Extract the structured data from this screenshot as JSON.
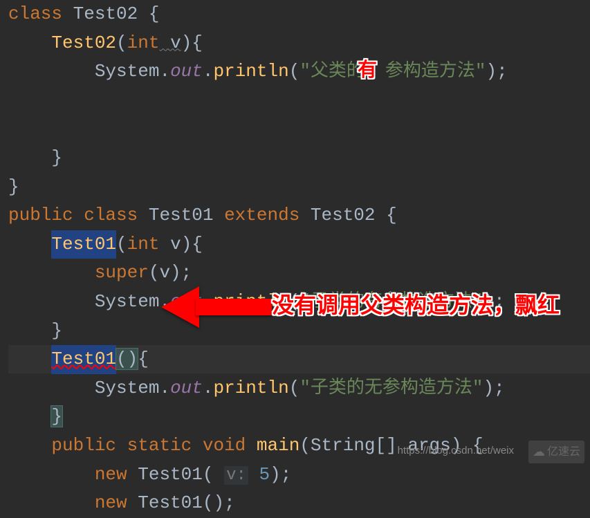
{
  "code": {
    "l0": "}",
    "l1_kw": "class",
    "l1_cls": " Test02 ",
    "l1_br": "{",
    "l2_ctor": "Test02",
    "l2_p1": "(",
    "l2_int": "int",
    "l2_v": " v",
    "l2_p2": "){",
    "l3_sys": "System",
    "l3_dot1": ".",
    "l3_out": "out",
    "l3_dot2": ".",
    "l3_println": "println",
    "l3_p1": "(",
    "l3_str1": "\"父类的",
    "l3_str2": "参构造方法\"",
    "l3_p2": ");",
    "l4_br": "}",
    "l5_br": "}",
    "l6_pub": "public",
    "l6_cls": " class",
    "l6_name": " Test01 ",
    "l6_ext": "extends",
    "l6_sup": " Test02 ",
    "l6_br": "{",
    "l7_ctor": "Test01",
    "l7_p1": "(",
    "l7_int": "int",
    "l7_v": " v",
    "l7_p2": "){",
    "l8_super": "super",
    "l8_p": "(v);",
    "l9_sys": "System",
    "l9_dot1": ".",
    "l9_out": "out",
    "l9_dot2": ".",
    "l9_println": "println",
    "l9_p1": "(",
    "l9_str": "\"子类的有参构造方法\"",
    "l9_p2": ");",
    "l10_br": "}",
    "l11_ctor": "Test01",
    "l11_p": "()",
    "l11_br": "{",
    "l12_sys": "System",
    "l12_dot1": ".",
    "l12_out": "out",
    "l12_dot2": ".",
    "l12_println": "println",
    "l12_p1": "(",
    "l12_str": "\"子类的无参构造方法\"",
    "l12_p2": ");",
    "l13_br": "}",
    "l14_pub": "public",
    "l14_stat": " static",
    "l14_void": " void",
    "l14_main": " main",
    "l14_p1": "(",
    "l14_str": "String",
    "l14_arr": "[] args) {",
    "l15_new": "new",
    "l15_ctor": " Test01( ",
    "l15_hint": "v:",
    "l15_num": " 5",
    "l15_p": ");",
    "l16_new": "new",
    "l16_ctor": " Test01();"
  },
  "annotations": {
    "inline_badge": "有",
    "arrow_text": "没有调用父类构造方法，飘红"
  },
  "watermarks": {
    "url": "https://blog.csdn.net/weix",
    "logo": "亿速云"
  }
}
